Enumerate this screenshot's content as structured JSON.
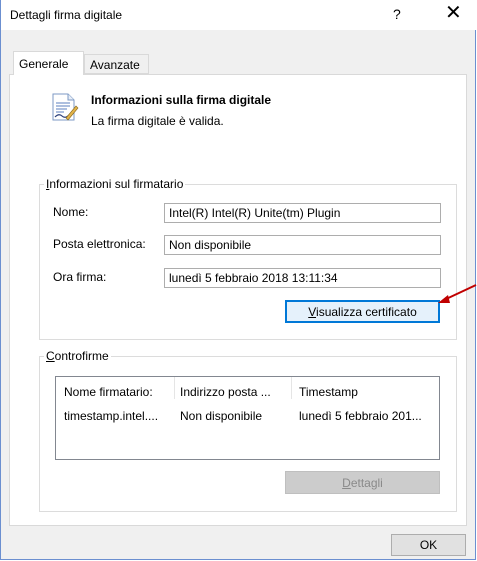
{
  "window": {
    "title": "Dettagli firma digitale",
    "help": "?",
    "close": "✕"
  },
  "tabs": [
    {
      "label": "Generale"
    },
    {
      "label": "Avanzate"
    }
  ],
  "info": {
    "icon": "certificate-document-icon",
    "title": "Informazioni sulla firma digitale",
    "subtitle": "La firma digitale è valida."
  },
  "signer": {
    "legend_first": "I",
    "legend_rest": "nformazioni sul firmatario",
    "name_label": "Nome:",
    "name_value": "Intel(R) Intel(R) Unite(tm) Plugin",
    "email_label": "Posta elettronica:",
    "email_value": "Non disponibile",
    "time_label": "Ora firma:",
    "time_value": "lunedì 5 febbraio 2018 13:11:34",
    "view_cert_first": "V",
    "view_cert_rest": "isualizza certificato"
  },
  "countersign": {
    "legend_first": "C",
    "legend_rest": "ontrofirme",
    "columns": [
      "Nome firmatario:",
      "Indirizzo posta ...",
      "Timestamp"
    ],
    "rows": [
      {
        "name": "timestamp.intel....",
        "email": "Non disponibile",
        "timestamp": "lunedì 5 febbraio 201..."
      }
    ],
    "details_first": "D",
    "details_rest": "ettagli"
  },
  "footer": {
    "ok": "OK"
  },
  "colors": {
    "accent": "#0078d7",
    "arrow": "#c00000"
  }
}
